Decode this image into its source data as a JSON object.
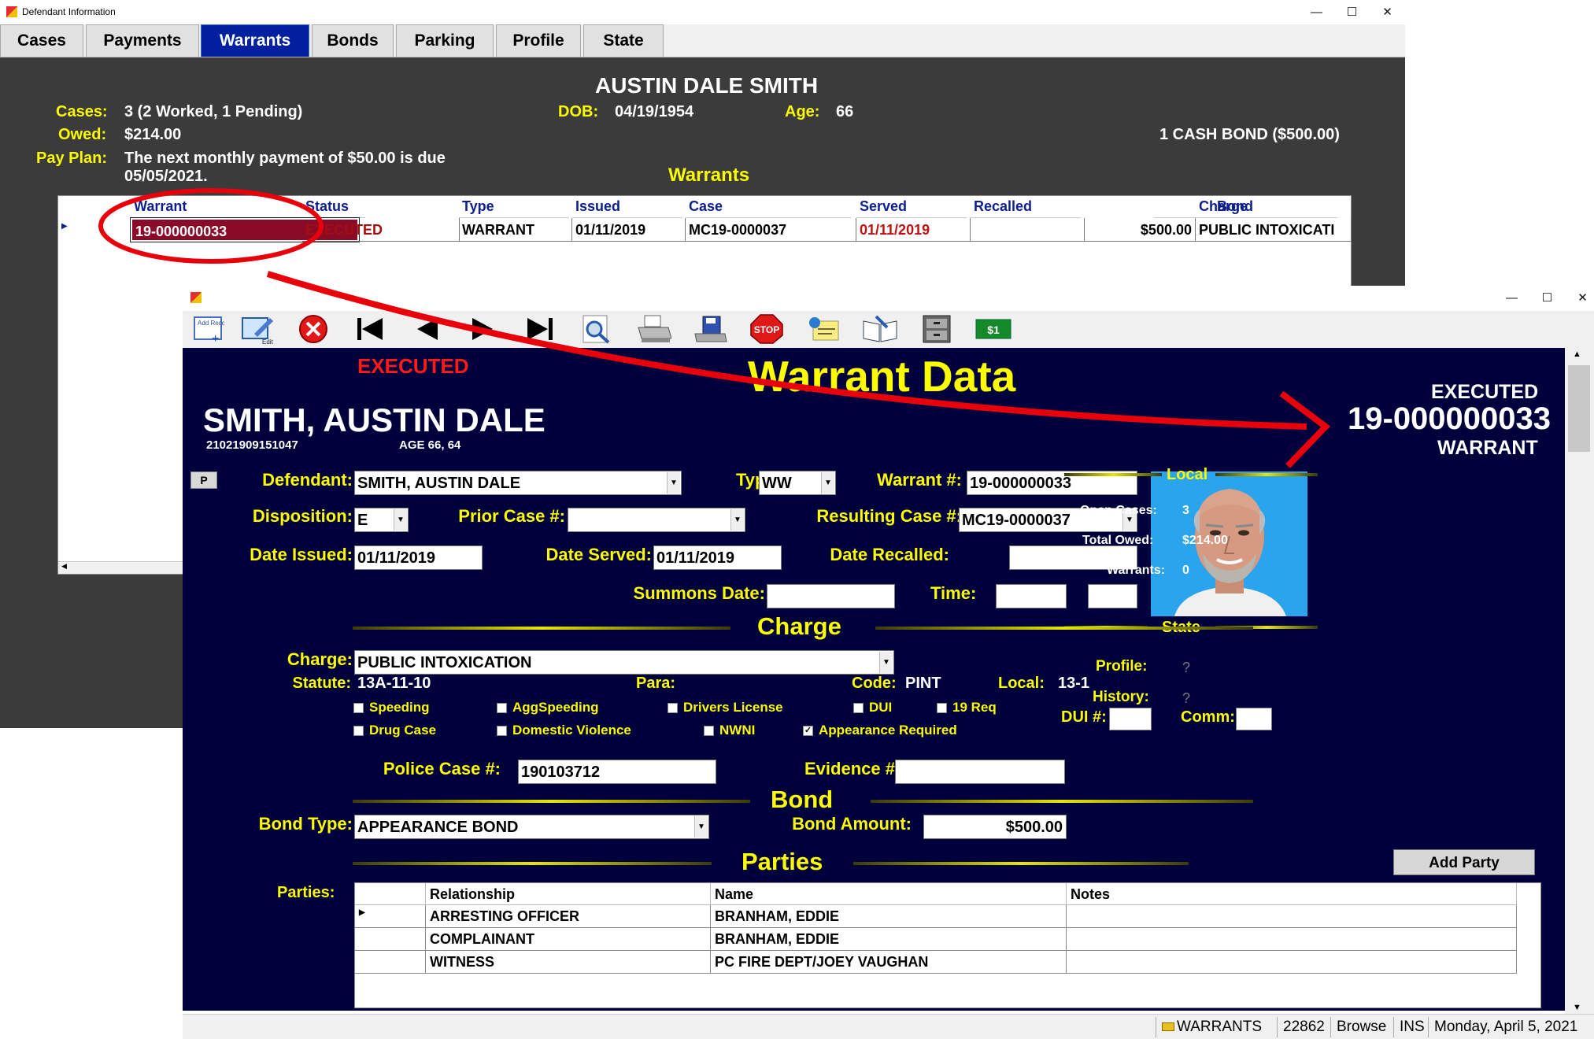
{
  "back_window": {
    "title": "Defendant Information",
    "tabs": [
      {
        "label": "Cases"
      },
      {
        "label": "Payments"
      },
      {
        "label": "Warrants",
        "active": true
      },
      {
        "label": "Bonds"
      },
      {
        "label": "Parking"
      },
      {
        "label": "Profile"
      },
      {
        "label": "State"
      }
    ],
    "defendant_name": "AUSTIN DALE SMITH",
    "cases_label": "Cases:",
    "cases_value": "3 (2 Worked, 1 Pending)",
    "owed_label": "Owed:",
    "owed_value": "$214.00",
    "payplan_label": "Pay Plan:",
    "payplan_value1": "The next monthly payment of $50.00 is due",
    "payplan_value2": "05/05/2021.",
    "dob_label": "DOB:",
    "dob_value": "04/19/1954",
    "age_label": "Age:",
    "age_value": "66",
    "bond_summary": "1 CASH BOND ($500.00)",
    "section_title": "Warrants",
    "grid": {
      "columns": [
        "Warrant",
        "Status",
        "Type",
        "Issued",
        "Case",
        "Served",
        "Recalled",
        "Bond",
        "Charge"
      ],
      "rows": [
        {
          "warrant": "19-000000033",
          "status": "EXECUTED",
          "type": "WARRANT",
          "issued": "01/11/2019",
          "case": "MC19-0000037",
          "served": "01/11/2019",
          "recalled": "",
          "bond": "$500.00",
          "charge": "PUBLIC INTOXICATI"
        }
      ]
    }
  },
  "front_window": {
    "toolbar": {
      "add_label": "Add Record",
      "edit_label": "Edit",
      "stop_label": "STOP",
      "money_label": "$1"
    },
    "status_top": "EXECUTED",
    "form_title": "Warrant Data",
    "name": "SMITH, AUSTIN DALE",
    "id_number": "21021909151047",
    "age_text": "AGE  66, 64",
    "p_button": "P",
    "header_right": {
      "status": "EXECUTED",
      "number": "19-000000033",
      "type": "WARRANT"
    },
    "fields": {
      "defendant_label": "Defendant:",
      "defendant_value": "SMITH, AUSTIN DALE",
      "type_label": "Type:",
      "type_value": "WW",
      "warrant_label": "Warrant #:",
      "warrant_value": "19-000000033",
      "disposition_label": "Disposition:",
      "disposition_value": "E",
      "prior_case_label": "Prior Case #:",
      "prior_case_value": "",
      "resulting_case_label": "Resulting Case #:",
      "resulting_case_value": "MC19-0000037",
      "date_issued_label": "Date Issued:",
      "date_issued_value": "01/11/2019",
      "date_served_label": "Date Served:",
      "date_served_value": "01/11/2019",
      "date_recalled_label": "Date Recalled:",
      "date_recalled_value": "",
      "summons_label": "Summons Date:",
      "summons_value": "",
      "time_label": "Time:",
      "time_value": "",
      "time_value2": ""
    },
    "charge_section": "Charge",
    "charge": {
      "charge_label": "Charge:",
      "charge_value": "PUBLIC INTOXICATION",
      "statute_label": "Statute:",
      "statute_value": "13A-11-10",
      "para_label": "Para:",
      "para_value": "",
      "code_label": "Code:",
      "code_value": "PINT",
      "local_label": "Local:",
      "local_value": "13-1"
    },
    "checkboxes": [
      {
        "label": "Speeding",
        "checked": false
      },
      {
        "label": "AggSpeeding",
        "checked": false
      },
      {
        "label": "Drivers License",
        "checked": false
      },
      {
        "label": "DUI",
        "checked": false
      },
      {
        "label": "19 Req",
        "checked": false
      },
      {
        "label": "Drug Case",
        "checked": false
      },
      {
        "label": "Domestic Violence",
        "checked": false
      },
      {
        "label": "NWNI",
        "checked": false
      },
      {
        "label": "Appearance Required",
        "checked": true
      }
    ],
    "dui_label": "DUI #:",
    "dui_value": "",
    "comm_label": "Comm:",
    "comm_value": "",
    "police_case_label": "Police Case #:",
    "police_case_value": "190103712",
    "evidence_label": "Evidence #:",
    "evidence_value": "",
    "bond_section": "Bond",
    "bond_type_label": "Bond Type:",
    "bond_type_value": "APPEARANCE BOND",
    "bond_amount_label": "Bond Amount:",
    "bond_amount_value": "$500.00",
    "parties_section": "Parties",
    "add_party_button": "Add Party",
    "parties_label": "Parties:",
    "parties_grid": {
      "columns": [
        "Relationship",
        "Name",
        "Notes"
      ],
      "rows": [
        {
          "relationship": "ARRESTING OFFICER",
          "name": "BRANHAM, EDDIE",
          "notes": ""
        },
        {
          "relationship": "COMPLAINANT",
          "name": "BRANHAM, EDDIE",
          "notes": ""
        },
        {
          "relationship": "WITNESS",
          "name": "PC FIRE DEPT/JOEY VAUGHAN",
          "notes": ""
        }
      ]
    },
    "local_panel": {
      "title": "Local",
      "open_cases_label": "Open Cases:",
      "open_cases_value": "3",
      "total_owed_label": "Total Owed:",
      "total_owed_value": "$214.00",
      "warrants_label": "Warrants:",
      "warrants_value": "0"
    },
    "state_panel": {
      "title": "State",
      "profile_label": "Profile:",
      "profile_value": "?",
      "history_label": "History:",
      "history_value": "?"
    },
    "statusbar": {
      "module": "WARRANTS",
      "record": "22862",
      "mode": "Browse",
      "ins": "INS",
      "date": "Monday, April 5, 2021"
    }
  },
  "colors": {
    "navy": "#00003c",
    "yellow": "#fcfc00",
    "executed_red": "#ff1a1a",
    "annotation_red": "#e8000a",
    "active_tab": "#0020a0"
  }
}
